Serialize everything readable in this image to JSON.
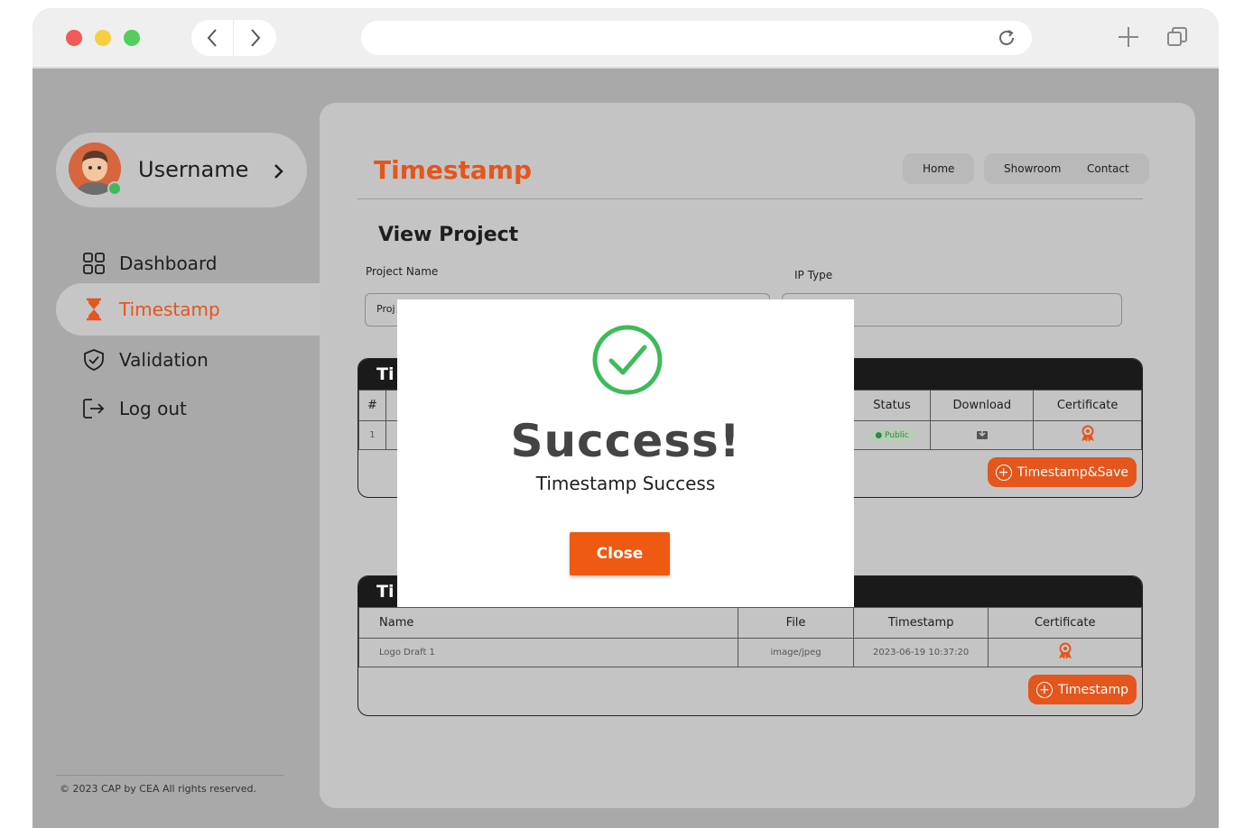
{
  "sidebar": {
    "username": "Username",
    "items": [
      {
        "label": "Dashboard",
        "icon": "grid-icon"
      },
      {
        "label": "Timestamp",
        "icon": "hourglass-icon",
        "active": true
      },
      {
        "label": "Validation",
        "icon": "shield-check-icon"
      },
      {
        "label": "Log out",
        "icon": "logout-icon"
      }
    ],
    "footer": "© 2023  CAP by CEA All rights reserved."
  },
  "header": {
    "title": "Timestamp",
    "nav": [
      "Home",
      "Showroom",
      "Contact"
    ]
  },
  "main": {
    "section_title": "View Project",
    "project_name_label": "Project Name",
    "project_name_value": "Proj",
    "ip_type_label": "IP Type",
    "ip_type_value": "",
    "card_one": {
      "title": "Ti",
      "columns": [
        "#",
        "Status",
        "Download",
        "Certificate"
      ],
      "rows": [
        {
          "num": "1",
          "status": "Public"
        }
      ],
      "action": "Timestamp&Save"
    },
    "card_two": {
      "title": "Ti",
      "columns": [
        "Name",
        "File",
        "Timestamp",
        "Certificate"
      ],
      "rows": [
        {
          "name": "Logo Draft 1",
          "file": "image/jpeg",
          "timestamp": "2023-06-19 10:37:20"
        }
      ],
      "action": "Timestamp"
    }
  },
  "modal": {
    "title": "Success!",
    "message": "Timestamp Success",
    "close_label": "Close"
  },
  "colors": {
    "accent": "#e4561c",
    "success": "#3dbb5b",
    "panel": "#c4c4c4",
    "backdrop": "#a9a9a9"
  }
}
